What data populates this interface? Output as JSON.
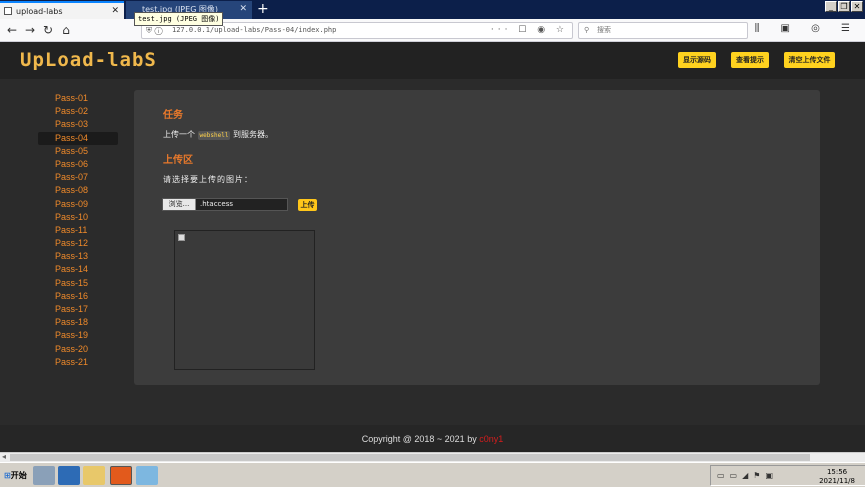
{
  "browser": {
    "tabs": [
      {
        "title": "upload-labs",
        "active": true
      },
      {
        "title": "test.jpg (JPEG 图像)",
        "active": false
      }
    ],
    "tooltip": "test.jpg (JPEG 图像)",
    "url": "127.0.0.1/upload-labs/Pass-04/index.php",
    "search_placeholder": "搜索",
    "new_tab": "+"
  },
  "header": {
    "logo": "UpLoad-labS",
    "buttons": [
      "显示源码",
      "查看提示",
      "清空上传文件"
    ]
  },
  "sidebar": {
    "items": [
      "Pass-01",
      "Pass-02",
      "Pass-03",
      "Pass-04",
      "Pass-05",
      "Pass-06",
      "Pass-07",
      "Pass-08",
      "Pass-09",
      "Pass-10",
      "Pass-11",
      "Pass-12",
      "Pass-13",
      "Pass-14",
      "Pass-15",
      "Pass-16",
      "Pass-17",
      "Pass-18",
      "Pass-19",
      "Pass-20",
      "Pass-21"
    ],
    "active_index": 3
  },
  "main": {
    "task_title": "任务",
    "task_prefix": "上传一个",
    "task_code": "webshell",
    "task_suffix": "到服务器。",
    "upload_title": "上传区",
    "choose_label": "请选择要上传的图片：",
    "browse_label": "浏览...",
    "file_name": ".htaccess",
    "upload_button": "上传"
  },
  "footer": {
    "copyright": "Copyright @ 2018 ~ 2021 by",
    "author": "c0ny1"
  },
  "taskbar": {
    "start_label": "开始",
    "time": "15:56",
    "date": "2021/11/8"
  },
  "colors": {
    "accent_orange": "#e9792b",
    "button_yellow": "#ffd21f",
    "background": "#2b2b2b",
    "panel": "#3c3c3c"
  }
}
